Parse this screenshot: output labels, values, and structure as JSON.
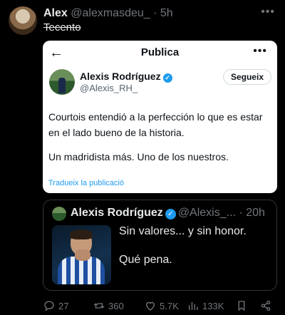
{
  "post": {
    "author_name": "Alex",
    "author_handle": "@alexmasdeu_",
    "separator": "·",
    "time": "5h",
    "text": "Tecento",
    "more_icon": "more-horizontal-icon"
  },
  "embedded_screenshot": {
    "title": "Publica",
    "author_name": "Alexis Rodríguez",
    "author_handle": "@Alexis_RH_",
    "follow_label": "Segueix",
    "paragraphs": [
      "Courtois entendió a la perfección lo que es estar en el lado bueno de la historia.",
      "Un madridista más. Uno de los nuestros."
    ],
    "translate_label": "Tradueix la publicació"
  },
  "quoted_tweet": {
    "author_name": "Alexis Rodríguez",
    "author_handle": "@Alexis_...",
    "separator": "·",
    "time": "20h",
    "lines": [
      "Sin valores... y sin honor.",
      "Qué pena."
    ]
  },
  "actions": {
    "replies": "27",
    "reposts": "360",
    "likes": "5.7K",
    "views": "133K"
  },
  "colors": {
    "background": "#000000",
    "verified": "#1d9bf0",
    "muted": "#71767b"
  }
}
